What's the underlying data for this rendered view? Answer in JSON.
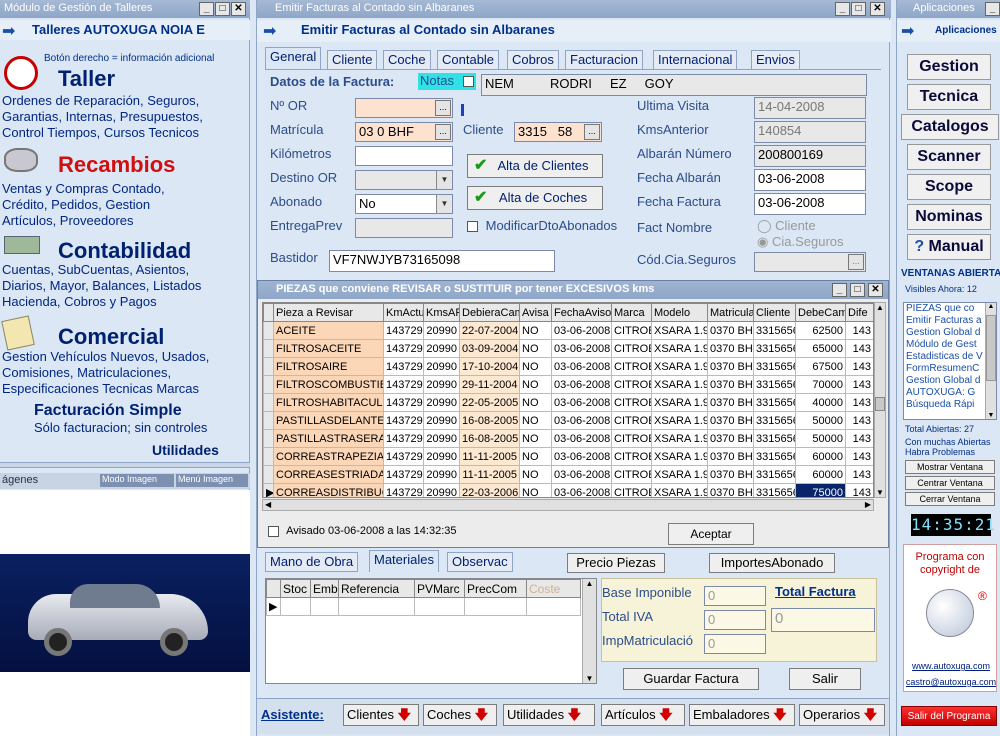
{
  "left_panel": {
    "title": "Módulo de Gestión de Talleres",
    "company": "Talleres AUTOXUGA NOIA E",
    "hint": "Botón derecho = información adicional",
    "sections": [
      {
        "title": "Taller",
        "lines": [
          "Ordenes de Reparación, Seguros,",
          "Garantias, Internas, Presupuestos,",
          "Control Tiempos, Cursos Tecnicos"
        ]
      },
      {
        "title": "Recambios",
        "lines": [
          "Ventas y Compras Contado,",
          "Crédito, Pedidos,  Gestion",
          "Artículos, Proveedores"
        ]
      },
      {
        "title": "Contabilidad",
        "lines": [
          "Cuentas, SubCuentas, Asientos,",
          "Diarios, Mayor, Balances, Listados",
          "Hacienda, Cobros y Pagos"
        ]
      },
      {
        "title": "Comercial",
        "lines": [
          "Gestion Vehículos Nuevos, Usados,",
          "Comisiones, Matriculaciones,",
          "Especificaciones Tecnicas Marcas"
        ]
      }
    ],
    "facturacion_title": "Facturación Simple",
    "facturacion_sub": "Sólo facturacion; sin controles",
    "utilidades": "Utilidades",
    "imagenes_label": "ágenes",
    "modo_imagen": "Modo Imagen",
    "menu_imagen": "Menú Imagen"
  },
  "main": {
    "title": "Emitir Facturas al Contado sin Albaranes",
    "header": "Emitir Facturas al Contado sin Albaranes",
    "tabs": [
      "General",
      "Cliente",
      "Coche",
      "Contable",
      "Cobros",
      "Facturacion",
      "Internacional",
      "Envios"
    ],
    "datos_label": "Datos de la Factura:",
    "notas_label": "Notas",
    "client_name": "NEM          RODRI     EZ     GOY",
    "labels": {
      "or": "Nº OR",
      "matricula": "Matrícula",
      "km": "Kilómetros",
      "destino": "Destino OR",
      "abonado": "Abonado",
      "entrega": "EntregaPrev",
      "bastidor": "Bastidor",
      "cliente": "Cliente",
      "ultima": "Ultima Visita",
      "kms_ant": "KmsAnterior",
      "albaran_num": "Albarán Número",
      "fecha_alb": "Fecha Albarán",
      "fecha_fac": "Fecha Factura",
      "fact_nombre": "Fact Nombre",
      "cod_cia": "Cód.Cia.Seguros"
    },
    "values": {
      "matricula": "03  0 BHF",
      "cliente": "3315   58",
      "abonado": "No",
      "bastidor": "VF7NWJYB73165098",
      "ultima": "14-04-2008",
      "kms_ant": "140854",
      "albaran_num": "200800169",
      "fecha_alb": "03-06-2008",
      "fecha_fac": "03-06-2008"
    },
    "alta_clientes": "Alta de Clientes",
    "alta_coches": "Alta de Coches",
    "modificar": "ModificarDtoAbonados",
    "radio_cliente": "Cliente",
    "radio_cia": "Cia.Seguros"
  },
  "piezas": {
    "title": "PIEZAS que conviene REVISAR o SUSTITUIR por tener EXCESIVOS kms",
    "columns": [
      "Pieza a Revisar",
      "KmActu",
      "KmsAF",
      "DebieraCam",
      "Avisa",
      "FechaAviso",
      "Marca",
      "Modelo",
      "Matricula",
      "Cliente",
      "DebeCam",
      "Dife"
    ],
    "rows": [
      [
        "ACEITE",
        "143729",
        "20990",
        "22-07-2004",
        "NO",
        "03-06-2008",
        "CITROE",
        "XSARA 1.9D",
        "0370 BH",
        "3315656",
        "62500",
        "143"
      ],
      [
        "FILTROSACEITE",
        "143729",
        "20990",
        "03-09-2004",
        "NO",
        "03-06-2008",
        "CITROE",
        "XSARA 1.9D",
        "0370 BH",
        "3315656",
        "65000",
        "143"
      ],
      [
        "FILTROSAIRE",
        "143729",
        "20990",
        "17-10-2004",
        "NO",
        "03-06-2008",
        "CITROE",
        "XSARA 1.9D",
        "0370 BH",
        "3315656",
        "67500",
        "143"
      ],
      [
        "FILTROSCOMBUSTIBLE",
        "143729",
        "20990",
        "29-11-2004",
        "NO",
        "03-06-2008",
        "CITROE",
        "XSARA 1.9D",
        "0370 BH",
        "3315656",
        "70000",
        "143"
      ],
      [
        "FILTROSHABITACULO",
        "143729",
        "20990",
        "22-05-2005",
        "NO",
        "03-06-2008",
        "CITROE",
        "XSARA 1.9D",
        "0370 BH",
        "3315656",
        "40000",
        "143"
      ],
      [
        "PASTILLASDELANTERAS",
        "143729",
        "20990",
        "16-08-2005",
        "NO",
        "03-06-2008",
        "CITROE",
        "XSARA 1.9D",
        "0370 BH",
        "3315656",
        "50000",
        "143"
      ],
      [
        "PASTILLASTRASERAS",
        "143729",
        "20990",
        "16-08-2005",
        "NO",
        "03-06-2008",
        "CITROE",
        "XSARA 1.9D",
        "0370 BH",
        "3315656",
        "50000",
        "143"
      ],
      [
        "CORREASTRAPEZIALES",
        "143729",
        "20990",
        "11-11-2005",
        "NO",
        "03-06-2008",
        "CITROE",
        "XSARA 1.9D",
        "0370 BH",
        "3315656",
        "60000",
        "143"
      ],
      [
        "CORREASESTRIADAS",
        "143729",
        "20990",
        "11-11-2005",
        "NO",
        "03-06-2008",
        "CITROE",
        "XSARA 1.9D",
        "0370 BH",
        "3315656",
        "60000",
        "143"
      ],
      [
        "CORREASDISTRIBUCION",
        "143729",
        "20990",
        "22-03-2006",
        "NO",
        "03-06-2008",
        "CITROE",
        "XSARA 1.9D",
        "0370 BH",
        "3315656",
        "75000",
        "143"
      ]
    ],
    "avisado": "Avisado 03-06-2008 a las 14:32:35",
    "aceptar": "Aceptar"
  },
  "bottom": {
    "tabs": [
      "Mano de Obra",
      "Materiales",
      "Observac"
    ],
    "precio_piezas": "Precio Piezas",
    "importes_abonado": "ImportesAbonado",
    "columns": [
      "Stoc",
      "Emb",
      "Referencia",
      "PVMarc",
      "PrecCom",
      "Coste"
    ],
    "base_imponible": "Base Imponible",
    "total_iva": "Total IVA",
    "imp_matric": "ImpMatriculació",
    "total_factura": "Total Factura",
    "zero": "0",
    "guardar": "Guardar Factura",
    "salir": "Salir",
    "asistente": "Asistente:",
    "asistente_items": [
      "Clientes",
      "Coches",
      "Utilidades",
      "Artículos",
      "Embaladores",
      "Operarios"
    ]
  },
  "right_panel": {
    "title": "Aplicaciones",
    "header": "Aplicaciones",
    "buttons": [
      "Gestion",
      "Tecnica",
      "Catalogos",
      "Scanner",
      "Scope",
      "Nominas",
      "Manual"
    ],
    "ventanas_abiertas": "VENTANAS ABIERTAS",
    "visibles": "Visibles Ahora: 12",
    "windows": [
      "PIEZAS que co",
      "Emitir Facturas a",
      "Gestion Global d",
      "Módulo de Gest",
      "Estadisticas de V",
      "FormResumenC",
      "Gestion Global d",
      "AUTOXUGA:  G",
      "Búsqueda Rápi"
    ],
    "total_abiertas": "Total Abiertas: 27",
    "warning": "Con muchas Abiertas Habra Problemas",
    "mostrar": "Mostrar Ventana",
    "centrar": "Centrar Ventana",
    "cerrar": "Cerrar Ventana",
    "clock": "14:35:21",
    "copyright": "Programa con copyright de",
    "url": "www.autoxuga.com",
    "email": "castro@autoxuga.com",
    "salir_programa": "Salir del Programa"
  }
}
